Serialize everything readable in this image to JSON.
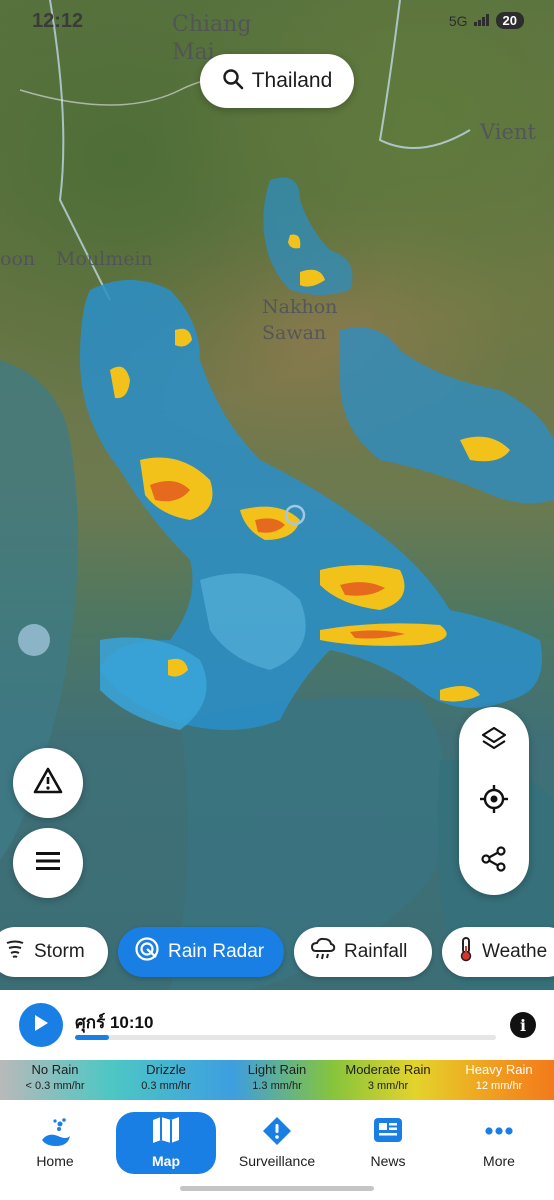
{
  "status_bar": {
    "time": "12:12",
    "signal": "5G",
    "battery": "20"
  },
  "map": {
    "labels": [
      "Chiang",
      "Mai",
      "Moulmein",
      "Nakhon",
      "Sawan",
      "Vient",
      "oon"
    ],
    "icons": [
      "radar-rain-overlay",
      "location-marker"
    ]
  },
  "search": {
    "label": "Thailand",
    "icon": "search-icon"
  },
  "floating": {
    "warning_icon": "warning-icon",
    "list_icon": "list-icon",
    "layers_icon": "layers-icon",
    "locate_icon": "locate-icon",
    "share_icon": "share-icon"
  },
  "chips": [
    {
      "label": "Storm",
      "icon": "storm-icon",
      "active": false
    },
    {
      "label": "Rain Radar",
      "icon": "radar-icon",
      "active": true
    },
    {
      "label": "Rainfall",
      "icon": "rainfall-icon",
      "active": false
    },
    {
      "label": "Weathe",
      "icon": "thermometer-icon",
      "active": false
    }
  ],
  "timeline": {
    "label": "ศุกร์ 10:10",
    "progress": 0.08,
    "play_icon": "play-icon",
    "info_label": "i"
  },
  "legend": [
    {
      "name": "No Rain",
      "value": "< 0.3 mm/hr"
    },
    {
      "name": "Drizzle",
      "value": "0.3 mm/hr"
    },
    {
      "name": "Light Rain",
      "value": "1.3 mm/hr"
    },
    {
      "name": "Moderate Rain",
      "value": "3 mm/hr"
    },
    {
      "name": "Heavy Rain",
      "value": "12 mm/hr"
    }
  ],
  "nav": [
    {
      "label": "Home",
      "icon": "home-icon"
    },
    {
      "label": "Map",
      "icon": "map-icon",
      "active": true
    },
    {
      "label": "Surveillance",
      "icon": "alert-icon"
    },
    {
      "label": "News",
      "icon": "news-icon"
    },
    {
      "label": "More",
      "icon": "more-icon"
    }
  ],
  "colors": {
    "accent": "#1a7fe5",
    "radar_blue": "#2a8fc9",
    "radar_yellow": "#f2c21a",
    "radar_orange": "#e66a1e"
  }
}
